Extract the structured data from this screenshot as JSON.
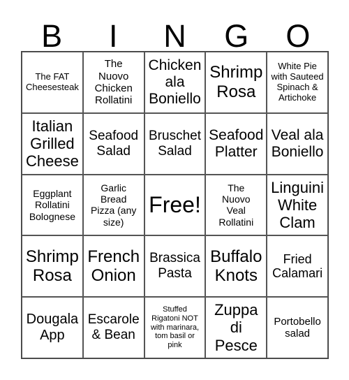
{
  "header": [
    "B",
    "I",
    "N",
    "G",
    "O"
  ],
  "cells": [
    [
      "The FAT\nCheesesteak",
      "The\nNuovo\nChicken\nRollatini",
      "Chicken\nala\nBoniello",
      "Shrimp\nRosa",
      "White Pie\nwith Sauteed\nSpinach &\nArtichoke"
    ],
    [
      "Italian\nGrilled\nCheese",
      "Seafood\nSalad",
      "Bruschet\nSalad",
      "Seafood\nPlatter",
      "Veal ala\nBoniello"
    ],
    [
      "Eggplant\nRollatini\nBolognese",
      "Garlic\nBread\nPizza (any\nsize)",
      "Free!",
      "The\nNuovo\nVeal\nRollatini",
      "Linguini\nWhite\nClam"
    ],
    [
      "Shrimp\nRosa",
      "French\nOnion",
      "Brassica\nPasta",
      "Buffalo\nKnots",
      "Fried\nCalamari"
    ],
    [
      "Dougala\nApp",
      "Escarole\n& Bean",
      "Stuffed\nRigatoni NOT\nwith marinara,\ntom basil or\npink",
      "Zuppa\ndi\nPesce",
      "Portobello\nsalad"
    ]
  ]
}
